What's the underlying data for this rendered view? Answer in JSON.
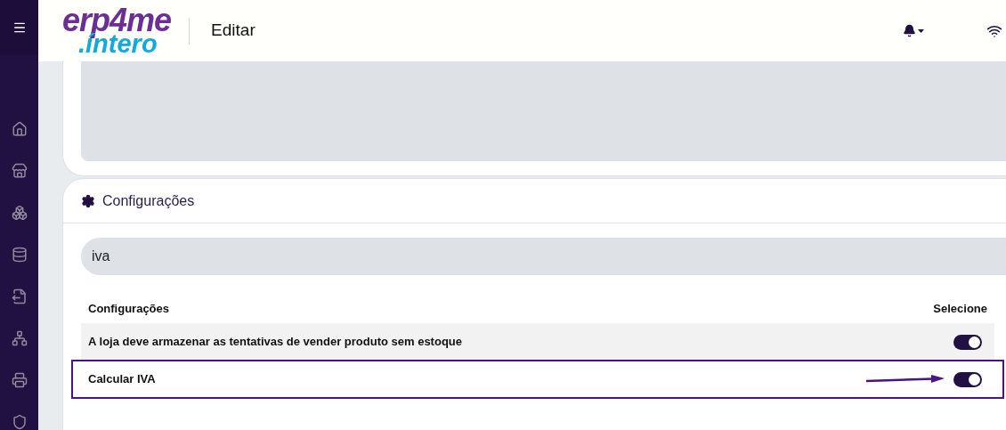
{
  "header": {
    "logo": {
      "top": "erp4me",
      "bottom": ".íntero"
    },
    "title": "Editar"
  },
  "config_section": {
    "title": "Configurações",
    "search": {
      "value": "iva"
    },
    "table": {
      "columns": [
        "Configurações",
        "Selecione"
      ],
      "rows": [
        {
          "label": "A loja deve armazenar as tentativas de vender produto sem estoque",
          "on": true,
          "highlighted": false,
          "striped": true
        },
        {
          "label": "Calcular IVA",
          "on": true,
          "highlighted": true,
          "striped": false
        }
      ]
    }
  }
}
